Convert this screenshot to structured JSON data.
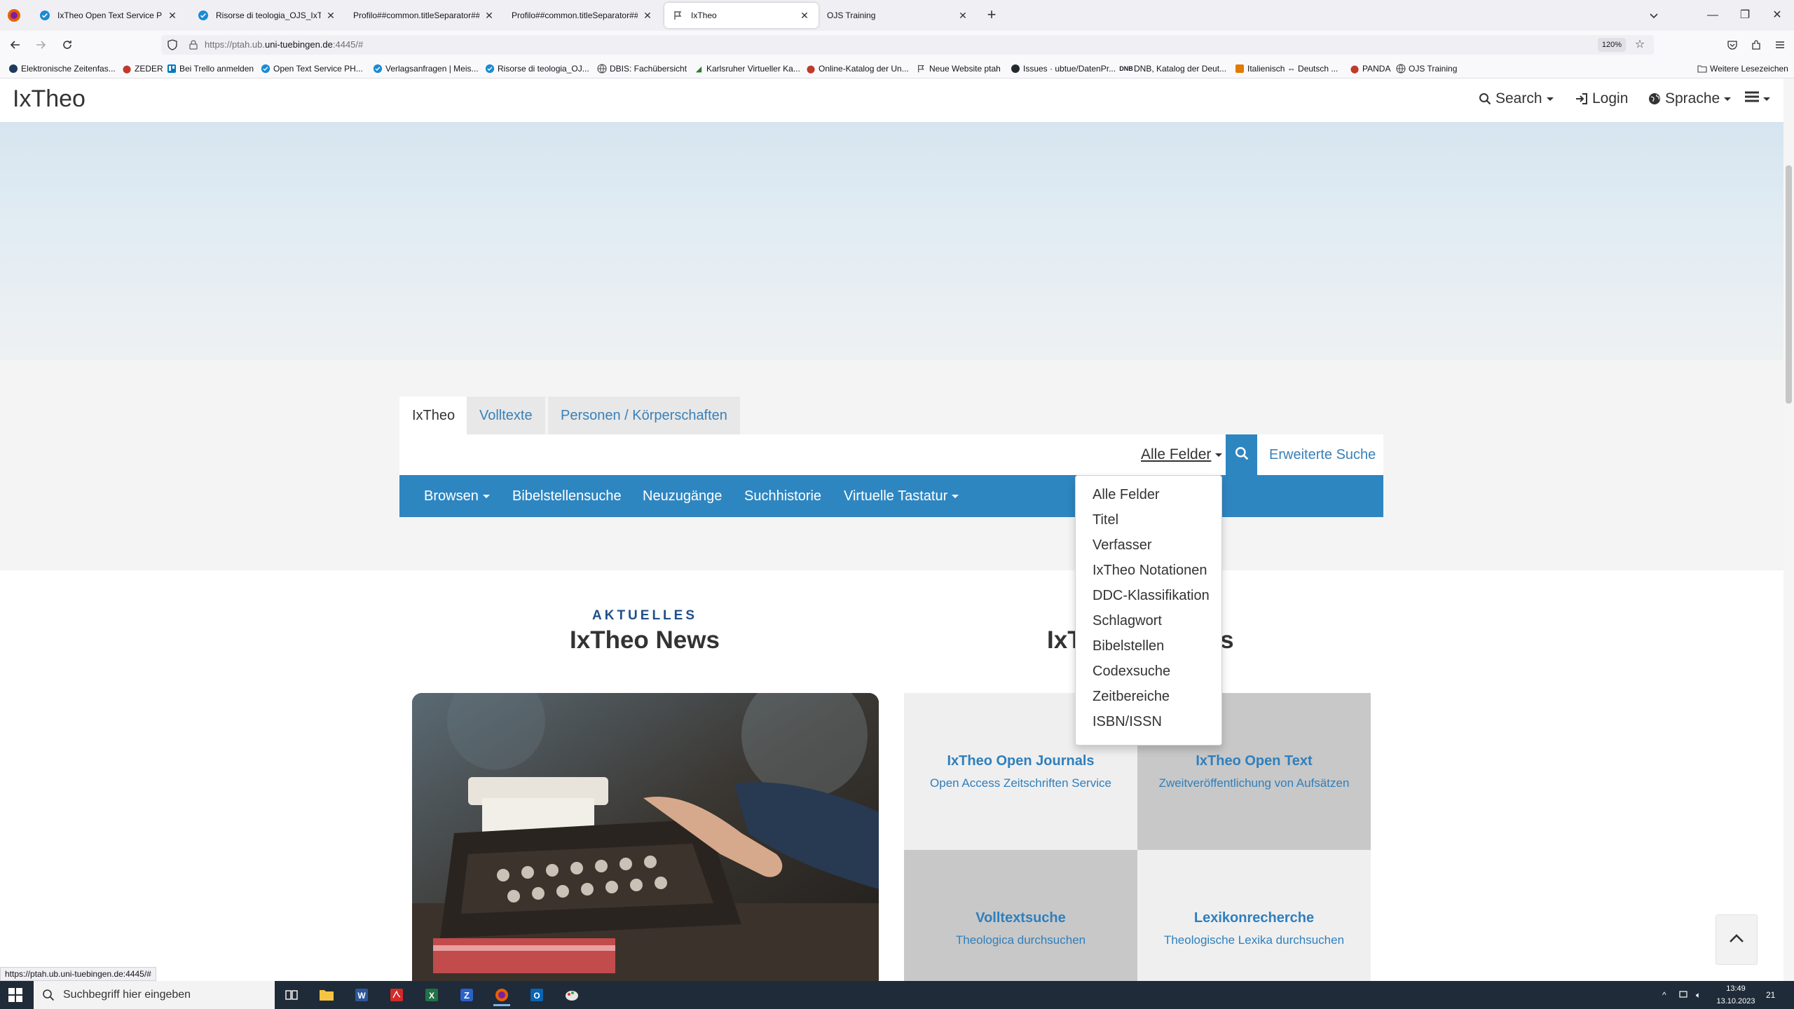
{
  "browser": {
    "tabs": [
      {
        "title": "IxTheo Open Text Service PHASE",
        "icon": "check-badge-icon",
        "active": false
      },
      {
        "title": "Risorse di teologia_OJS_IxTheo |",
        "icon": "check-badge-icon",
        "active": false
      },
      {
        "title": "Profilo##common.titleSeparator##",
        "icon": "",
        "active": false
      },
      {
        "title": "Profilo##common.titleSeparator##",
        "icon": "",
        "active": false
      },
      {
        "title": "IxTheo",
        "icon": "ixtheo-favicon",
        "active": true
      },
      {
        "title": "OJS Training",
        "icon": "",
        "active": false
      }
    ],
    "url_prefix": "https://ptah.ub.",
    "url_host": "uni-tuebingen.de",
    "url_suffix": ":4445/#",
    "zoom": "120%",
    "bookmarks": [
      {
        "label": "Elektronische Zeitenfas..."
      },
      {
        "label": "ZEDER"
      },
      {
        "label": "Bei Trello anmelden"
      },
      {
        "label": "Open Text Service PH..."
      },
      {
        "label": "Verlagsanfragen | Meis..."
      },
      {
        "label": "Risorse di teologia_OJ..."
      },
      {
        "label": "DBIS: Fachübersicht"
      },
      {
        "label": "Karlsruher Virtueller Ka..."
      },
      {
        "label": "Online-Katalog der Un..."
      },
      {
        "label": "Neue Website ptah"
      },
      {
        "label": "Issues · ubtue/DatenPr..."
      },
      {
        "label": "DNB, Katalog der Deut..."
      },
      {
        "label": "Italienisch ⇔ Deutsch ..."
      },
      {
        "label": "PANDA"
      },
      {
        "label": "OJS Training"
      }
    ],
    "other_bookmarks": "Weitere Lesezeichen",
    "status_url": "https://ptah.ub.uni-tuebingen.de:4445/#"
  },
  "site": {
    "logo": "IxTheo",
    "header": {
      "search": "Search",
      "login": "Login",
      "language": "Sprache"
    },
    "search_tabs": [
      "IxTheo",
      "Volltexte",
      "Personen / Körperschaften"
    ],
    "search_input_placeholder": "",
    "field_select": "Alle Felder",
    "advanced_search": "Erweiterte Suche",
    "blue_bar": {
      "browse": "Browsen",
      "bible": "Bibelstellensuche",
      "new": "Neuzugänge",
      "history": "Suchhistorie",
      "keyboard": "Virtuelle Tastatur"
    },
    "field_options": [
      "Alle Felder",
      "Titel",
      "Verfasser",
      "IxTheo Notationen",
      "DDC-Klassifikation",
      "Schlagwort",
      "Bibelstellen",
      "Codexsuche",
      "Zeitbereiche",
      "ISBN/ISSN"
    ],
    "news": {
      "kicker": "AKTUELLES",
      "title": "IxTheo News"
    },
    "services_title": "IxTheo Services",
    "tiles": [
      {
        "title": "IxTheo Open Journals",
        "subtitle": "Open Access Zeitschriften Service"
      },
      {
        "title": "IxTheo Open Text",
        "subtitle": "Zweitveröffentlichung von Aufsätzen"
      },
      {
        "title": "Volltextsuche",
        "subtitle": "Theologica durchsuchen"
      },
      {
        "title": "Lexikonrecherche",
        "subtitle": "Theologische Lexika durchsuchen"
      }
    ]
  },
  "taskbar": {
    "search_placeholder": "Suchbegriff hier eingeben",
    "time": "13:49",
    "date": "13.10.2023",
    "notifications": "21"
  },
  "colors": {
    "accent_blue": "#2e86c1",
    "link_blue": "#3a80b8",
    "kicker_blue": "#1f4f8a"
  }
}
